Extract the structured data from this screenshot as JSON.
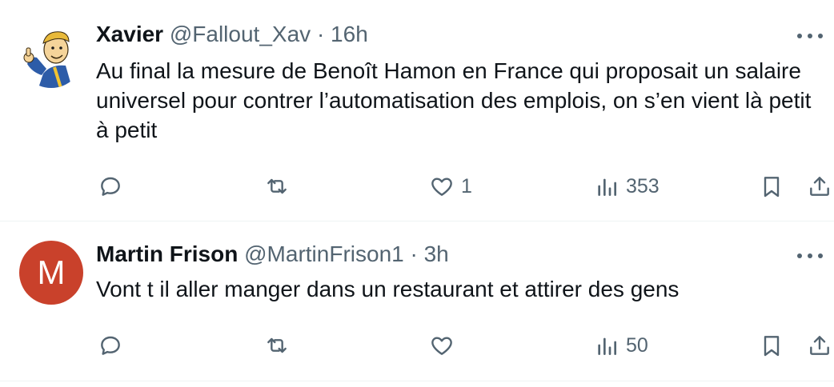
{
  "tweets": [
    {
      "name": "Xavier",
      "handle": "@Fallout_Xav",
      "dot": "·",
      "time": "16h",
      "avatar_icon": "vault-boy-avatar",
      "text": "Au final la mesure de Benoît Hamon en France qui proposait un salaire universel pour contrer l’automatisation des emplois, on s’en vient là petit à petit",
      "likes": "1",
      "views": "353"
    },
    {
      "name": "Martin Frison",
      "handle": "@MartinFrison1",
      "dot": "·",
      "time": "3h",
      "avatar_letter": "M",
      "avatar_color": "#c9412b",
      "text": "Vont t il aller manger dans un restaurant et attirer des gens",
      "likes": "",
      "views": "50"
    }
  ],
  "colors": {
    "text": "#0f1419",
    "secondary": "#536471",
    "divider": "#eff3f4"
  }
}
